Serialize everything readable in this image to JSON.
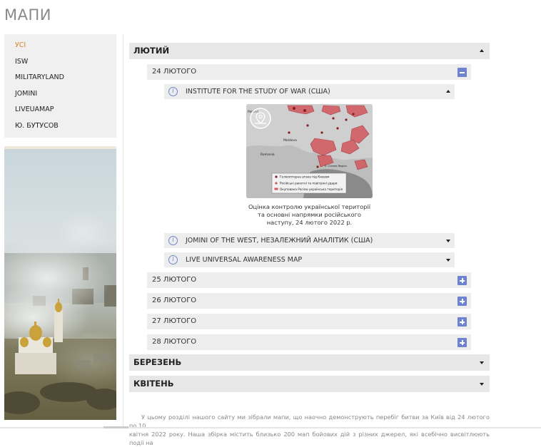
{
  "page": {
    "title": "МАПИ"
  },
  "sidebar": {
    "items": [
      {
        "label": "УСІ",
        "active": true
      },
      {
        "label": "ISW",
        "active": false
      },
      {
        "label": "MILITARYLAND",
        "active": false
      },
      {
        "label": "JOMINI",
        "active": false
      },
      {
        "label": "LIVEUAMAP",
        "active": false
      },
      {
        "label": "Ю. БУТУСОВ",
        "active": false
      }
    ]
  },
  "accordion": {
    "months": [
      {
        "label": "ЛЮТИЙ",
        "expanded": true
      },
      {
        "label": "БЕРЕЗЕНЬ",
        "expanded": false
      },
      {
        "label": "КВІТЕНЬ",
        "expanded": false
      }
    ],
    "days": [
      {
        "label": "24 ЛЮТОГО",
        "expanded": true
      },
      {
        "label": "25 ЛЮТОГО",
        "expanded": false
      },
      {
        "label": "26 ЛЮТОГО",
        "expanded": false
      },
      {
        "label": "27 ЛЮТОГО",
        "expanded": false
      },
      {
        "label": "28 ЛЮТОГО",
        "expanded": false
      }
    ],
    "sources": [
      {
        "label": "INSTITUTE FOR THE STUDY OF WAR (США)",
        "expanded": true
      },
      {
        "label": "JOMINI OF THE WEST, НЕЗАЛЕЖНИЙ АНАЛІТИК (США)",
        "expanded": false
      },
      {
        "label": "LIVE UNIVERSAL AWARENESS MAP",
        "expanded": false
      }
    ]
  },
  "map_card": {
    "caption_lines": [
      "Оцінка контролю української території",
      "та основні напрямки російського",
      "наступу, 24 лютого 2022 р."
    ],
    "map_labels": {
      "country_poland": "Poland",
      "country_moldova": "Moldova",
      "country_romania": "Romania",
      "region_crimea": "E. Crimea Region"
    },
    "legend": [
      "Гелікоптерна атака під Києвом",
      "Російські ракетні та повітряні удари",
      "Окупована Росією українська територія"
    ]
  },
  "footer": {
    "line1": "У цьому розділі нашого сайту ми зібрали мапи, що наочно демонструють перебіг битви за Київ від 24 лютого по 10",
    "line2": "квітня 2022 року. Наша збірка містить близько 200 мап бойових дій з різних джерел, які всебічно висвітлюють події на"
  },
  "colors": {
    "accent_active": "#d4862a",
    "toggle_blue": "#6d83cf",
    "info_blue": "#6f86c9",
    "bar_bg": "#e7e7e7"
  }
}
